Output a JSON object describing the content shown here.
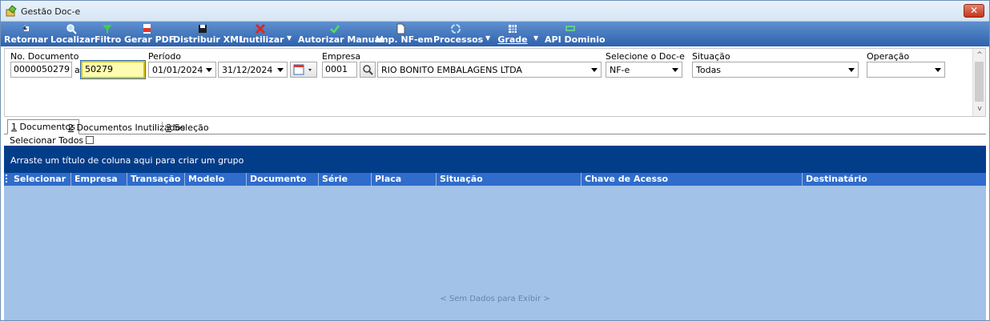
{
  "window": {
    "title": "Gestão Doc-e",
    "close_label": "✕"
  },
  "toolbar": {
    "retornar": "Retornar",
    "localizar": "Localizar",
    "filtro": "Filtro",
    "gerar_pdf": "Gerar PDF",
    "distribuir_xml": "Distribuir XML",
    "inutilizar": "Inutilizar",
    "autorizar_manual": "Autorizar Manual",
    "imp_nfem": "Imp. NF-em",
    "processos": "Processos",
    "grade": "Grade",
    "api_dominio": "API Dominio",
    "dropdown_arrow": "▼"
  },
  "filters": {
    "no_documento_label": "No. Documento",
    "doc_from": "0000050279",
    "range_sep": "a",
    "doc_to": "50279",
    "periodo_label": "Período",
    "date_from": "01/01/2024",
    "date_to": "31/12/2024",
    "empresa_label": "Empresa",
    "empresa_code": "0001",
    "empresa_name": "RIO BONITO EMBALAGENS LTDA",
    "doce_label": "Selecione o Doc-e",
    "doce_value": "NF-e",
    "situacao_label": "Situação",
    "situacao_value": "Todas",
    "operacao_label": "Operação",
    "operacao_value": ""
  },
  "tabs": [
    {
      "key": "1",
      "label": " Documentos"
    },
    {
      "key": "2",
      "label": " Documentos Inutilizados"
    },
    {
      "key": "3",
      "label": " Seleção"
    }
  ],
  "selecionar_todos": "Selecionar Todos",
  "grid": {
    "group_hint": "Arraste um título de coluna aqui para criar um grupo",
    "columns": [
      "Selecionar",
      "Empresa",
      "Transação",
      "Modelo",
      "Documento",
      "Série",
      "Placa",
      "Situação",
      "Chave de Acesso",
      "Destinatário"
    ],
    "empty_message": "< Sem Dados para Exibir >"
  },
  "colors": {
    "toolbar": "#3a6fb9",
    "group_bar": "#023d8a",
    "grid_header": "#2f6ccc",
    "grid_body": "#a3c2e8",
    "highlight": "#fffbb0"
  }
}
